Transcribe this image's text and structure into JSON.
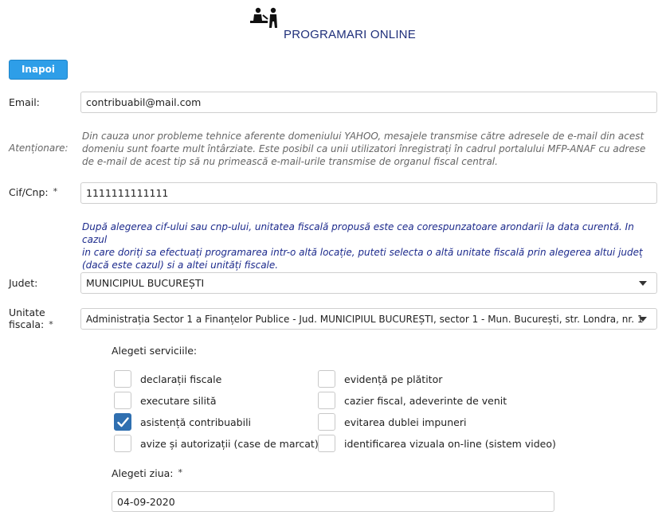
{
  "header": {
    "title": "PROGRAMARI ONLINE",
    "logo_icon": "two-people-desk-icon"
  },
  "back_button": {
    "label": "Inapoi"
  },
  "email": {
    "label": "Email:",
    "value": "contribuabil@mail.com"
  },
  "attention": {
    "label": "Atenționare:",
    "text_lines": [
      "Din cauza unor probleme tehnice aferente domeniului YAHOO, mesajele transmise către adresele de e-mail din acest",
      "domeniu sunt foarte mult întârziate. Este posibil ca unii utilizatori înregistrați în cadrul portalului MFP-ANAF cu adrese",
      "de e-mail de acest tip să nu primească e-mail-urile transmise de organul fiscal central."
    ]
  },
  "cif": {
    "label": "Cif/Cnp:",
    "required": "*",
    "value": "1111111111111"
  },
  "cif_note": {
    "text_lines": [
      "După alegerea cif-ului sau cnp-ului, unitatea fiscală propusă este cea corespunzatoare arondarii la data curentă. In cazul",
      "in care doriți sa efectuați programarea intr-o altă locație, puteti selecta o altă unitate fiscală prin alegerea altui județ",
      "(dacă este cazul) si a altei unități fiscale."
    ]
  },
  "judet": {
    "label": "Judet:",
    "value": "MUNICIPIUL BUCUREȘTI"
  },
  "unitate": {
    "label_line1": "Unitate",
    "label_line2": "fiscala:",
    "required": "*",
    "value": "Administrația Sector 1 a Finanțelor Publice - Jud. MUNICIPIUL BUCUREȘTI, sector 1 - Mun. București, str. Londra, nr. 1"
  },
  "services": {
    "heading": "Alegeti serviciile:",
    "left": [
      {
        "label": "declarații fiscale",
        "checked": false
      },
      {
        "label": "executare silită",
        "checked": false
      },
      {
        "label": "asistență contribuabili",
        "checked": true
      },
      {
        "label": "avize și autorizații (case de marcat)",
        "checked": false
      }
    ],
    "right": [
      {
        "label": "evidență pe plătitor",
        "checked": false
      },
      {
        "label": "cazier fiscal, adeverinte de venit",
        "checked": false
      },
      {
        "label": "evitarea dublei impuneri",
        "checked": false
      },
      {
        "label": "identificarea vizuala on-line (sistem video)",
        "checked": false
      }
    ]
  },
  "day": {
    "label": "Alegeti ziua:",
    "required": "*",
    "value": "04-09-2020"
  },
  "colors": {
    "accent": "#2e9ee8",
    "title": "#1f2f7a",
    "note_blue": "#1c2a8c",
    "checkbox_checked": "#2f6fb0"
  }
}
